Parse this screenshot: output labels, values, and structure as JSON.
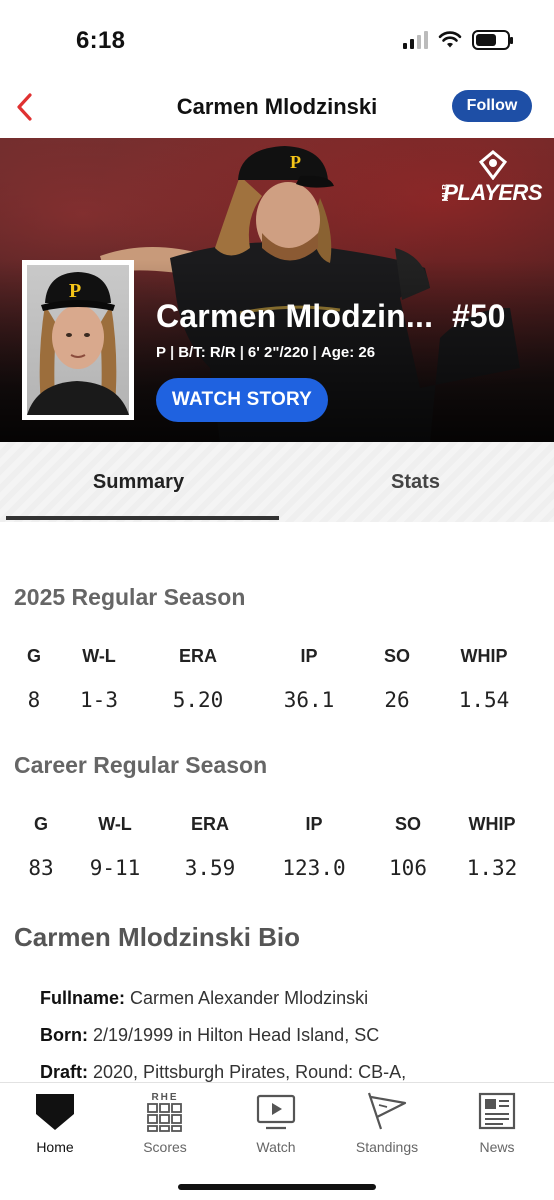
{
  "status": {
    "time": "6:18",
    "battery_level": 0.65,
    "icons": [
      "cellular-signal-icon",
      "wifi-icon",
      "battery-icon"
    ]
  },
  "nav": {
    "title": "Carmen Mlodzinski",
    "follow_label": "Follow",
    "back_icon": "chevron-left-icon"
  },
  "hero": {
    "brand": "PLAYERS",
    "brand_small": "MLB",
    "name": "Carmen Mlodzin...",
    "number": "#50",
    "position": "P",
    "bats_throws": "B/T: R/R",
    "height_weight": "6' 2\"/220",
    "age": "Age: 26",
    "watch_label": "WATCH STORY"
  },
  "tabs": [
    {
      "label": "Summary",
      "active": true
    },
    {
      "label": "Stats",
      "active": false
    }
  ],
  "season": {
    "title": "2025 Regular Season",
    "headers": [
      "G",
      "W-L",
      "ERA",
      "IP",
      "SO",
      "WHIP"
    ],
    "values": [
      "8",
      "1-3",
      "5.20",
      "36.1",
      "26",
      "1.54"
    ]
  },
  "career": {
    "title": "Career Regular Season",
    "headers": [
      "G",
      "W-L",
      "ERA",
      "IP",
      "SO",
      "WHIP"
    ],
    "values": [
      "83",
      "9-11",
      "3.59",
      "123.0",
      "106",
      "1.32"
    ]
  },
  "bio": {
    "title": "Carmen Mlodzinski Bio",
    "lines": [
      {
        "label": "Fullname:",
        "value": "Carmen Alexander Mlodzinski"
      },
      {
        "label": "Born:",
        "value": "2/19/1999 in Hilton Head Island, SC"
      },
      {
        "label": "Draft:",
        "value": "2020, Pittsburgh Pirates, Round: CB-A,"
      }
    ]
  },
  "bottom_nav": [
    {
      "label": "Home",
      "icon": "home-plate-icon",
      "active": true
    },
    {
      "label": "Scores",
      "icon": "scoreboard-icon",
      "active": false
    },
    {
      "label": "Watch",
      "icon": "play-video-icon",
      "active": false
    },
    {
      "label": "Standings",
      "icon": "pennant-flag-icon",
      "active": false
    },
    {
      "label": "News",
      "icon": "newspaper-icon",
      "active": false
    }
  ],
  "colors": {
    "accent_red": "#e03131",
    "follow_blue": "#1e4fa6",
    "watch_blue": "#1f62e0"
  }
}
